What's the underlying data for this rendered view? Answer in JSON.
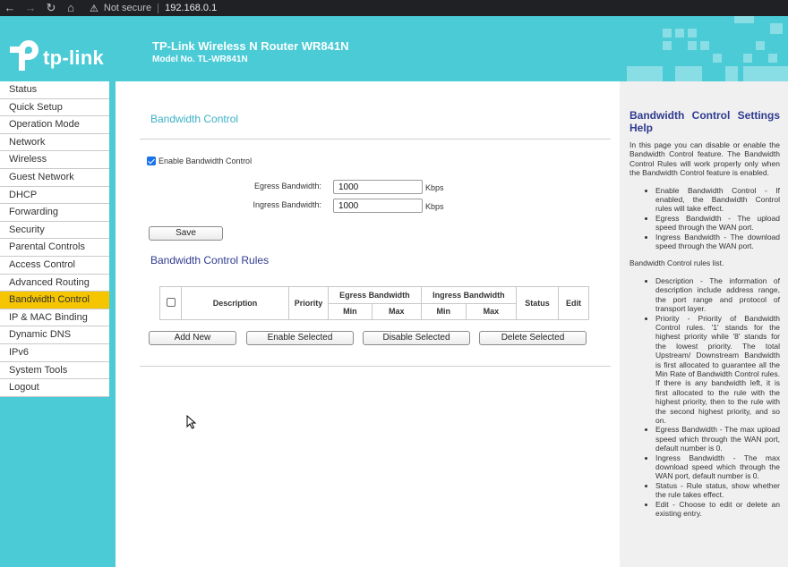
{
  "browser": {
    "back_icon": "arrow-left-icon",
    "forward_icon": "arrow-right-icon",
    "reload_icon": "reload-icon",
    "home_icon": "home-icon",
    "security_label": "Not secure",
    "url": "192.168.0.1"
  },
  "header": {
    "logo_text": "tp-link",
    "title": "TP-Link Wireless N Router WR841N",
    "model": "Model No. TL-WR841N",
    "color": "#4acbd6"
  },
  "sidebar": {
    "items": [
      {
        "label": "Status"
      },
      {
        "label": "Quick Setup"
      },
      {
        "label": "Operation Mode"
      },
      {
        "label": "Network"
      },
      {
        "label": "Wireless"
      },
      {
        "label": "Guest Network"
      },
      {
        "label": "DHCP"
      },
      {
        "label": "Forwarding"
      },
      {
        "label": "Security"
      },
      {
        "label": "Parental Controls"
      },
      {
        "label": "Access Control"
      },
      {
        "label": "Advanced Routing"
      },
      {
        "label": "Bandwidth Control"
      },
      {
        "label": "IP & MAC Binding"
      },
      {
        "label": "Dynamic DNS"
      },
      {
        "label": "IPv6"
      },
      {
        "label": "System Tools"
      },
      {
        "label": "Logout"
      }
    ],
    "active": "Bandwidth Control",
    "active_color": "#f5c500"
  },
  "main": {
    "section_title": "Bandwidth Control",
    "enable_label": "Enable Bandwidth Control",
    "enable_checked": true,
    "egress_label": "Egress Bandwidth:",
    "egress_value": "1000",
    "ingress_label": "Ingress Bandwidth:",
    "ingress_value": "1000",
    "unit": "Kbps",
    "save_label": "Save",
    "rules_title": "Bandwidth Control Rules",
    "table": {
      "headers": {
        "description": "Description",
        "priority": "Priority",
        "egress": "Egress Bandwidth",
        "ingress": "Ingress Bandwidth",
        "min": "Min",
        "max": "Max",
        "status": "Status",
        "edit": "Edit"
      }
    },
    "buttons": {
      "add_new": "Add New",
      "enable_selected": "Enable Selected",
      "disable_selected": "Disable Selected",
      "delete_selected": "Delete Selected"
    }
  },
  "help": {
    "title": "Bandwidth Control Settings Help",
    "intro": "In this page you can disable or enable the Bandwidth Control feature. The Bandwidth Control Rules will work properly only when the Bandwidth Control feature is enabled.",
    "list1": [
      "Enable Bandwidth Control - If enabled, the Bandwidth Control rules will take effect.",
      "Egress Bandwidth - The upload speed through the WAN port.",
      "Ingress Bandwidth - The download speed through the WAN port."
    ],
    "rules_intro": "Bandwidth Control rules list.",
    "list2": [
      "Description - The information of description include address range, the port range and protocol of transport layer.",
      "Priority - Priority of Bandwidth Control rules. '1' stands for the highest priority while '8' stands for the lowest priority. The total Upstream/ Downstream Bandwidth is first allocated to guarantee all the Min Rate of Bandwidth Control rules. If there is any bandwidth left, it is first allocated to the rule with the highest priority, then to the rule with the second highest priority, and so on.",
      "Egress Bandwidth - The max upload speed which through the WAN port, default number is 0.",
      "Ingress Bandwidth - The max download speed which through the WAN port, default number is 0.",
      "Status - Rule status, show whether the rule takes effect.",
      "Edit - Choose to edit or delete an existing entry."
    ]
  }
}
